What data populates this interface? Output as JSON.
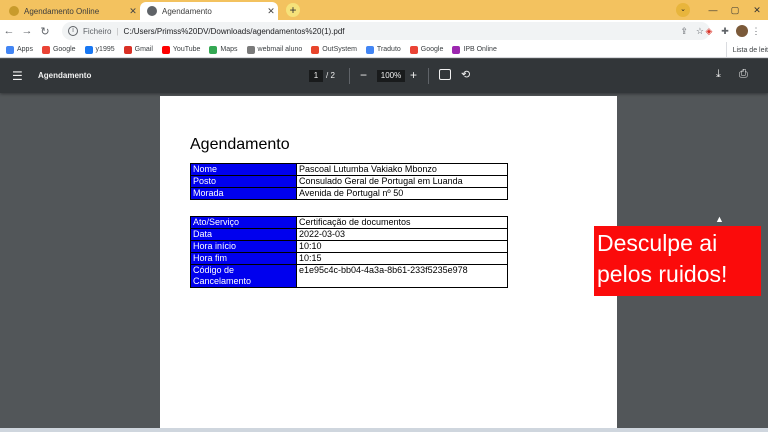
{
  "browser": {
    "tabs": [
      {
        "title": "Agendamento Online",
        "active": false
      },
      {
        "title": "Agendamento",
        "active": true
      }
    ],
    "new_tab": "+",
    "address": {
      "scheme": "Ficheiro",
      "url": "C:/Users/Primss%20DV/Downloads/agendamentos%20(1).pdf"
    },
    "bookmarks": [
      {
        "label": "Apps",
        "color": "#4285f4"
      },
      {
        "label": "Google",
        "color": "#ea4335"
      },
      {
        "label": "y1995",
        "color": "#1877f2"
      },
      {
        "label": "Gmail",
        "color": "#d93025"
      },
      {
        "label": "YouTube",
        "color": "#ff0000"
      },
      {
        "label": "Maps",
        "color": "#34a853"
      },
      {
        "label": "webmail aluno",
        "color": "#7a7a7a"
      },
      {
        "label": "OutSystem",
        "color": "#e8452c"
      },
      {
        "label": "Traduto",
        "color": "#4285f4"
      },
      {
        "label": "Google",
        "color": "#ea4335"
      },
      {
        "label": "IPB Online",
        "color": "#9c27b0"
      }
    ],
    "reading_list": "Lista de leit"
  },
  "pdf_toolbar": {
    "title": "Agendamento",
    "current_page": "1",
    "total_pages": "/ 2",
    "zoom": "100%"
  },
  "document": {
    "heading": "Agendamento",
    "table1": [
      {
        "key": "Nome",
        "value": "Pascoal Lutumba Vakiako Mbonzo"
      },
      {
        "key": "Posto",
        "value": "Consulado Geral de Portugal em Luanda"
      },
      {
        "key": "Morada",
        "value": "Avenida de Portugal nº 50"
      }
    ],
    "table2": [
      {
        "key": "Ato/Serviço",
        "value": "Certificação de documentos"
      },
      {
        "key": "Data",
        "value": "2022-03-03"
      },
      {
        "key": "Hora início",
        "value": "10:10"
      },
      {
        "key": "Hora fim",
        "value": "10:15"
      },
      {
        "key": "Código de Cancelamento",
        "value": "e1e95c4c-bb04-4a3a-8b61-233f5235e978"
      }
    ]
  },
  "annotation": {
    "line1": "Desculpe ai",
    "line2": "pelos ruidos!"
  },
  "colors": {
    "key_cell": "#0000ee",
    "annotation_bg": "#fb0b0b",
    "tab_strip": "#f3c25f"
  }
}
